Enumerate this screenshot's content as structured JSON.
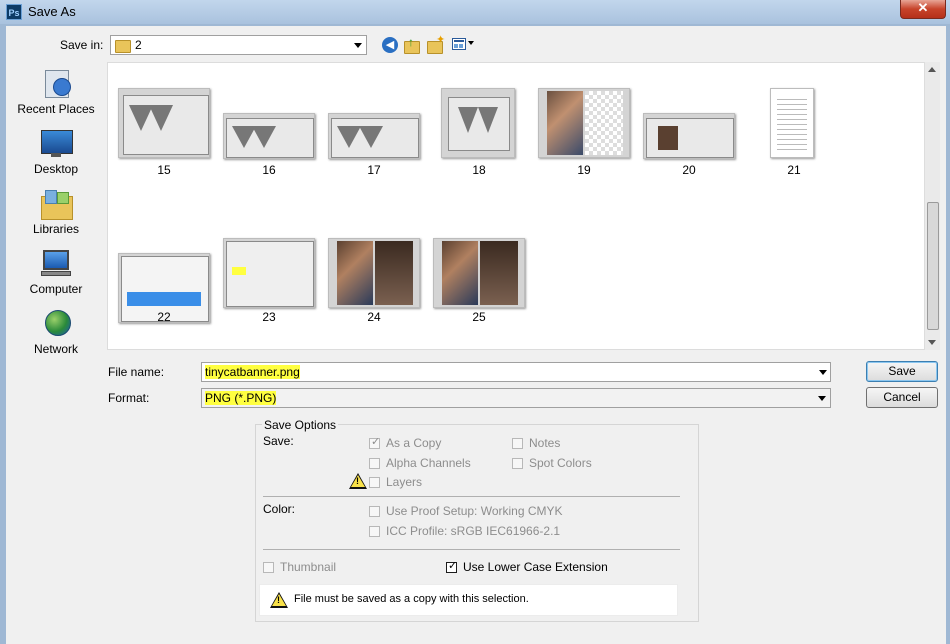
{
  "window": {
    "title": "Save As",
    "app_icon": "Ps",
    "close": "✕"
  },
  "save_in": {
    "label": "Save in:",
    "value": "2"
  },
  "toolbar": {
    "icons": [
      "back-icon",
      "up-folder-icon",
      "new-folder-icon",
      "view-menu-icon"
    ]
  },
  "places": [
    {
      "label": "Recent Places",
      "icon": "recent-places-icon"
    },
    {
      "label": "Desktop",
      "icon": "desktop-icon"
    },
    {
      "label": "Libraries",
      "icon": "libraries-icon"
    },
    {
      "label": "Computer",
      "icon": "computer-icon"
    },
    {
      "label": "Network",
      "icon": "network-icon"
    }
  ],
  "files": [
    "15",
    "16",
    "17",
    "18",
    "19",
    "20",
    "21",
    "22",
    "23",
    "24",
    "25"
  ],
  "file_name": {
    "label": "File name:",
    "value": "tinycatbanner.png"
  },
  "format": {
    "label": "Format:",
    "value": "PNG (*.PNG)"
  },
  "buttons": {
    "save": "Save",
    "cancel": "Cancel"
  },
  "save_options": {
    "title": "Save Options",
    "save_label": "Save:",
    "as_copy": "As a Copy",
    "alpha_channels": "Alpha Channels",
    "layers": "Layers",
    "notes": "Notes",
    "spot_colors": "Spot Colors",
    "color_label": "Color:",
    "use_proof_setup": "Use Proof Setup:  Working CMYK",
    "icc_profile": "ICC Profile:  sRGB IEC61966-2.1",
    "thumbnail": "Thumbnail",
    "lower_case": "Use Lower Case Extension",
    "warning": "File must be saved as a copy with this selection."
  },
  "colors": {
    "highlight": "#ffff40",
    "title_bar": "#a9c2de"
  }
}
